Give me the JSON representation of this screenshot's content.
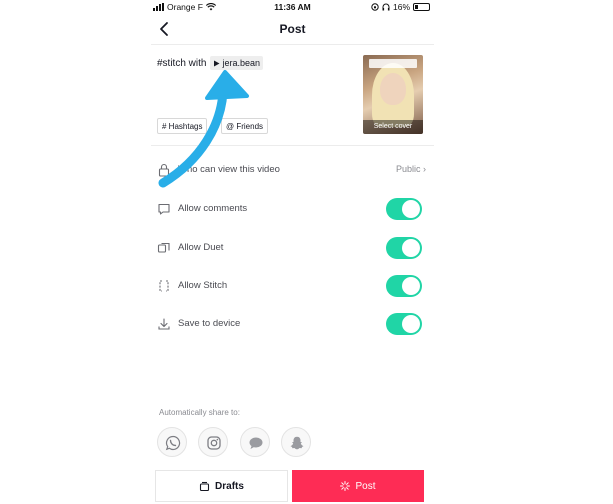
{
  "status_bar": {
    "carrier": "Orange F",
    "time": "11:36 AM",
    "battery": "16%"
  },
  "header": {
    "title": "Post",
    "back_icon": "chevron-left-icon"
  },
  "caption": {
    "prefix": "#stitch with",
    "mention": "jera.bean"
  },
  "cover": {
    "label": "Select cover"
  },
  "chips": {
    "hashtags": "# Hashtags",
    "friends": "@ Friends"
  },
  "settings": {
    "who_can_view": {
      "label": "Who can view this video",
      "value": "Public"
    },
    "allow_comments": {
      "label": "Allow comments",
      "enabled": true
    },
    "allow_duet": {
      "label": "Allow Duet",
      "enabled": true
    },
    "allow_stitch": {
      "label": "Allow Stitch",
      "enabled": true
    },
    "save_to_device": {
      "label": "Save to device",
      "enabled": true
    }
  },
  "share": {
    "label": "Automatically share to:",
    "targets": [
      "whatsapp-icon",
      "instagram-icon",
      "messages-icon",
      "snapchat-icon"
    ]
  },
  "actions": {
    "drafts": "Drafts",
    "post": "Post"
  },
  "colors": {
    "toggle_on": "#20d5a6",
    "post_button": "#fe2c55",
    "arrow": "#29aee8"
  }
}
